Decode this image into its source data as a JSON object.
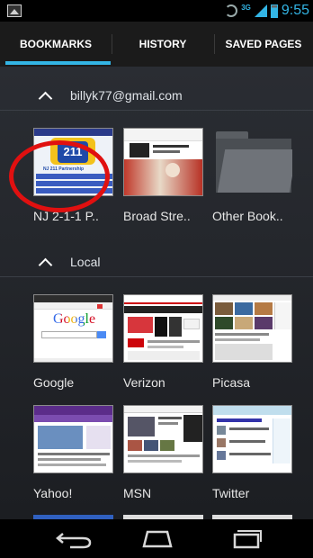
{
  "status_bar": {
    "icons": [
      "picture-icon",
      "sync-icon",
      "signal-icon",
      "battery-icon"
    ],
    "network": "3G",
    "clock": "9:55"
  },
  "tabs": [
    {
      "label": "BOOKMARKS",
      "selected": true
    },
    {
      "label": "HISTORY",
      "selected": false
    },
    {
      "label": "SAVED PAGES",
      "selected": false
    }
  ],
  "sections": [
    {
      "title": "billyk77@gmail.com",
      "items": [
        {
          "label": "NJ 2-1-1 P..",
          "thumb": "nj211"
        },
        {
          "label": "Broad Stre..",
          "thumb": "broadstreet"
        },
        {
          "label": "Other Book..",
          "thumb": "folder"
        }
      ]
    },
    {
      "title": "Local",
      "items": [
        {
          "label": "Google",
          "thumb": "google"
        },
        {
          "label": "Verizon",
          "thumb": "verizon"
        },
        {
          "label": "Picasa",
          "thumb": "picasa"
        },
        {
          "label": "Yahoo!",
          "thumb": "yahoo"
        },
        {
          "label": "MSN",
          "thumb": "msn"
        },
        {
          "label": "Twitter",
          "thumb": "twitter"
        }
      ]
    }
  ],
  "thumbnail_text": {
    "nj211_number": "211",
    "nj211_title": "NJ 211 Partnership",
    "google_logo": "Google"
  },
  "navigation": {
    "icons": [
      "back-icon",
      "home-icon",
      "recent-apps-icon"
    ]
  },
  "colors": {
    "accent": "#33b5e5",
    "highlight_ring": "#e01010"
  }
}
